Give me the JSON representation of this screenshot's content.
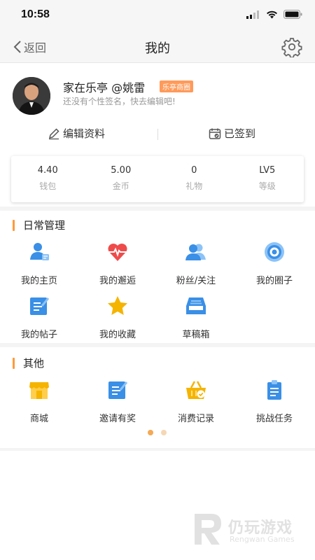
{
  "status_bar": {
    "time": "10:58"
  },
  "nav": {
    "back_label": "返回",
    "title": "我的"
  },
  "profile": {
    "name": "家在乐亭 @姚雷",
    "badge": "乐亭商圈",
    "signature": "还没有个性签名，快去编辑吧!"
  },
  "actions": {
    "edit_label": "编辑资料",
    "checkin_label": "已签到"
  },
  "stats": [
    {
      "value": "4.40",
      "label": "钱包"
    },
    {
      "value": "5.00",
      "label": "金币"
    },
    {
      "value": "0",
      "label": "礼物"
    },
    {
      "value": "LV5",
      "label": "等级"
    }
  ],
  "daily": {
    "title": "日常管理",
    "items": [
      {
        "label": "我的主页",
        "icon": "user-profile-icon"
      },
      {
        "label": "我的邂逅",
        "icon": "heart-pulse-icon"
      },
      {
        "label": "粉丝/关注",
        "icon": "followers-icon"
      },
      {
        "label": "我的圈子",
        "icon": "circle-target-icon"
      },
      {
        "label": "我的帖子",
        "icon": "post-edit-icon"
      },
      {
        "label": "我的收藏",
        "icon": "star-icon"
      },
      {
        "label": "草稿箱",
        "icon": "inbox-tray-icon"
      }
    ]
  },
  "other": {
    "title": "其他",
    "items": [
      {
        "label": "商城",
        "icon": "shop-icon"
      },
      {
        "label": "邀请有奖",
        "icon": "invite-icon"
      },
      {
        "label": "消费记录",
        "icon": "basket-icon"
      },
      {
        "label": "挑战任务",
        "icon": "clipboard-icon"
      }
    ]
  },
  "pager": {
    "pages": 2,
    "active": 1
  },
  "watermark": {
    "cn": "仍玩游戏",
    "en": "Rengwan Games"
  },
  "colors": {
    "accent": "#ff9a3a",
    "icon_blue": "#3a8fe6",
    "icon_red": "#ef4b4b",
    "icon_yellow": "#f5b400"
  }
}
